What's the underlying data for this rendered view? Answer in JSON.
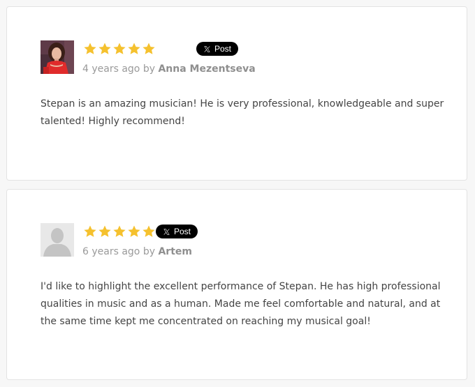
{
  "reviews": [
    {
      "rating": 5,
      "post_label": "Post",
      "time_ago": "4 years ago",
      "by_word": "by",
      "author": "Anna Mezentseva",
      "text": "Stepan is an amazing musician! He is very professional, knowledgeable and super talented! Highly recommend!"
    },
    {
      "rating": 5,
      "post_label": "Post",
      "time_ago": "6 years ago",
      "by_word": "by",
      "author": "Artem",
      "text": "I'd like to highlight the excellent performance of Stepan. He has high professional qualities in music and as a human. Made me feel comfortable and natural, and at the same time kept me concentrated on reaching my musical goal!"
    }
  ],
  "colors": {
    "star": "#f5c12e",
    "post_button_bg": "#000000",
    "meta_text": "#9a9a9a",
    "body_text": "#444444"
  },
  "icons": {
    "star": "star-icon",
    "post": "x-logo-icon",
    "avatar_photo": "user-photo",
    "avatar_placeholder": "default-user-silhouette"
  }
}
